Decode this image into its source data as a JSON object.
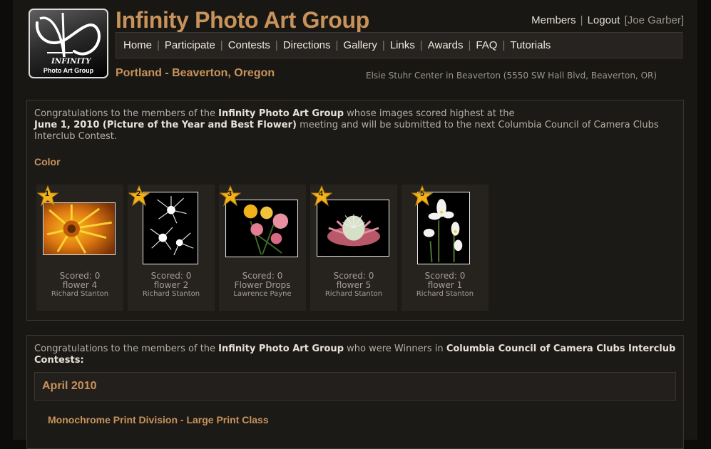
{
  "header": {
    "logo_text_main": "INFINITY",
    "logo_text_sub": "Photo Art Group",
    "site_title": "Infinity Photo Art Group",
    "user_links": {
      "members": "Members",
      "logout": "Logout",
      "user": "[Joe Garber]"
    },
    "nav": [
      "Home",
      "Participate",
      "Contests",
      "Directions",
      "Gallery",
      "Links",
      "Awards",
      "FAQ",
      "Tutorials"
    ],
    "location": "Portland - Beaverton, Oregon",
    "venue": "Elsie Stuhr Center in Beaverton (5550 SW Hall Blvd, Beaverton, OR)"
  },
  "results": {
    "intro_1": "Congratulations to the members of the ",
    "intro_group": "Infinity Photo Art Group",
    "intro_2": " whose images scored highest at the",
    "meeting_date": "June 1, 2010",
    "meeting_name_open": " (",
    "meeting_name": "Picture of the Year and Best Flower",
    "meeting_name_close": ")",
    "intro_3": " meeting and will be submitted to the next Columbia Council of Camera Clubs Interclub Contest.",
    "category": "Color",
    "entries": [
      {
        "rank": "1",
        "score": "Scored: 0",
        "title": "flower 4",
        "author": "Richard Stanton"
      },
      {
        "rank": "2",
        "score": "Scored: 0",
        "title": "flower 2",
        "author": "Richard Stanton"
      },
      {
        "rank": "3",
        "score": "Scored: 0",
        "title": "Flower Drops",
        "author": "Lawrence Payne"
      },
      {
        "rank": "4",
        "score": "Scored: 0",
        "title": "flower 5",
        "author": "Richard Stanton"
      },
      {
        "rank": "5",
        "score": "Scored: 0",
        "title": "flower 1",
        "author": "Richard Stanton"
      }
    ]
  },
  "winners": {
    "intro_1": "Congratulations to the members of the ",
    "intro_group": "Infinity Photo Art Group",
    "intro_2": " who were Winners in ",
    "council": "Columbia Council of Camera Clubs Interclub Contests:",
    "month": "April 2010",
    "division": "Monochrome Print Division - Large Print Class"
  },
  "colors": {
    "accent": "#c8935a",
    "background": "#191714",
    "star": "#f2b21c"
  }
}
